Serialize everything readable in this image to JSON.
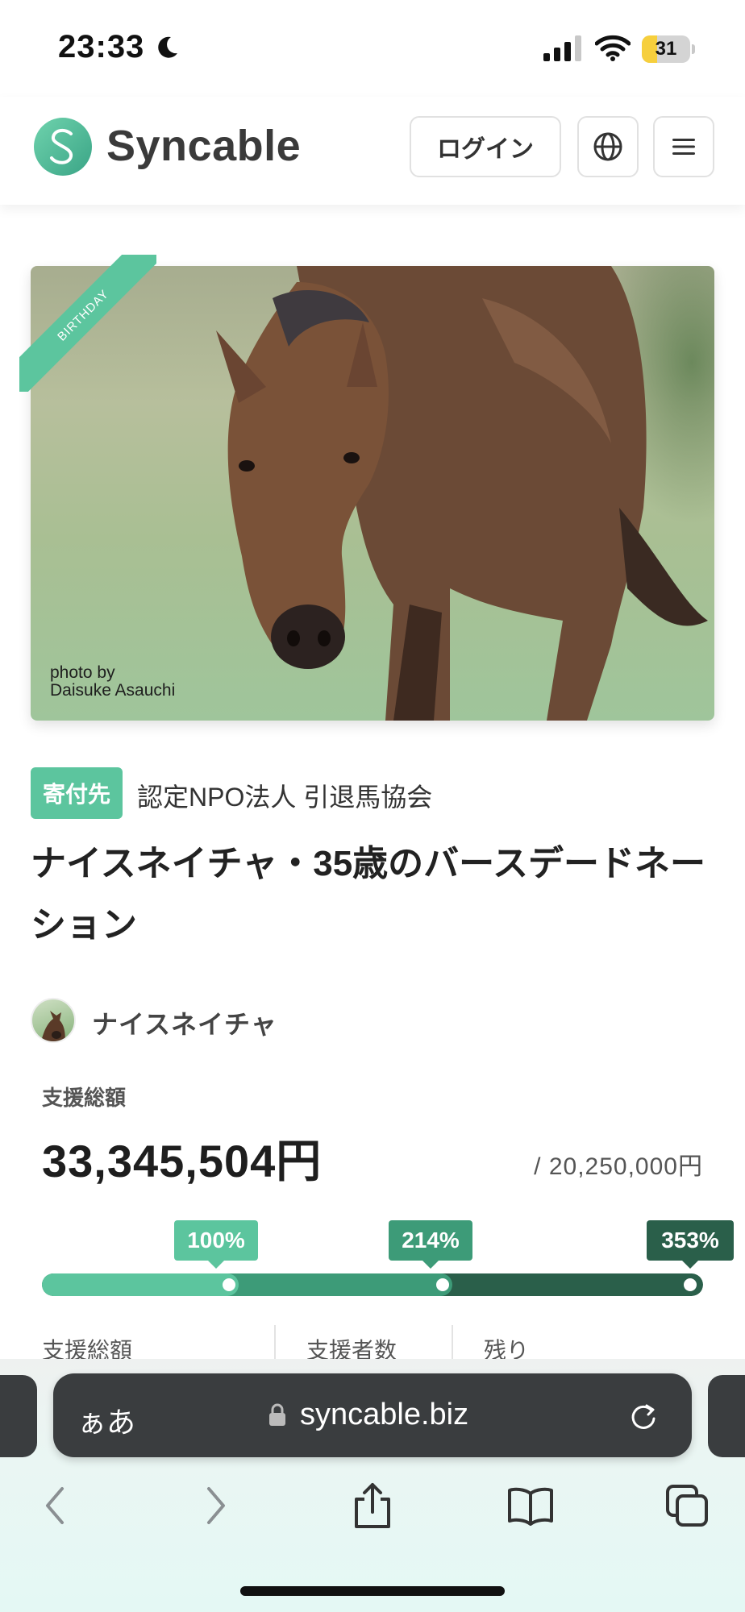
{
  "status_bar": {
    "time": "23:33",
    "battery_level": "31",
    "battery_fraction": 0.31
  },
  "header": {
    "logo_letter": "S",
    "logo_text": "Syncable",
    "login_label": "ログイン",
    "globe_icon": "globe-icon",
    "menu_icon": "hamburger-menu-icon"
  },
  "hero": {
    "ribbon_text": "BIRTHDAY",
    "photo_credit_line1": "photo by",
    "photo_credit_line2": "Daisuke Asauchi"
  },
  "campaign": {
    "tag": "寄付先",
    "recipient": "認定NPO法人 引退馬協会",
    "title": "ナイスネイチャ・35歳のバースデードネーション",
    "author": "ナイスネイチャ"
  },
  "funding": {
    "total_label": "支援総額",
    "total_amount": "33,345,504円",
    "goal": "/ 20,250,000円",
    "milestones": [
      {
        "label": "100%",
        "value": 100
      },
      {
        "label": "214%",
        "value": 214
      },
      {
        "label": "353%",
        "value": 353
      }
    ],
    "colors": [
      "#5cc59e",
      "#3d9b78",
      "#2a5f4a"
    ]
  },
  "stats": {
    "total": "支援総額",
    "supporters": "支援者数",
    "remaining": "残り"
  },
  "browser": {
    "text_size_label": "ぁあ",
    "url": "syncable.biz",
    "icons": [
      "back-icon",
      "forward-icon",
      "share-icon",
      "bookmarks-icon",
      "tabs-icon"
    ]
  }
}
